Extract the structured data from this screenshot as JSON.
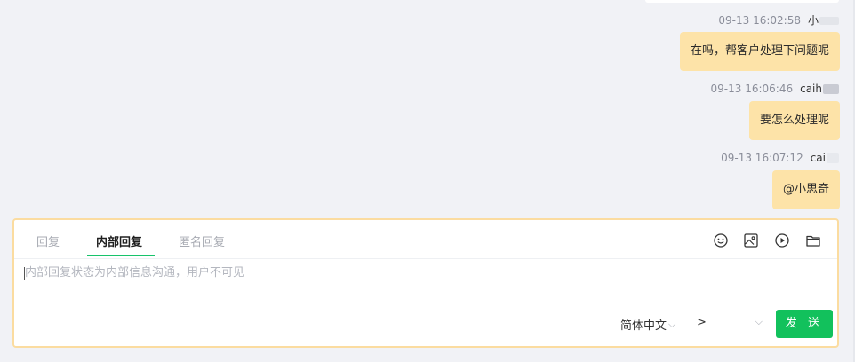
{
  "messages": [
    {
      "time": "09-13 16:02:58",
      "name": "小",
      "text": "在吗，帮客户处理下问题呢"
    },
    {
      "time": "09-13 16:06:46",
      "name": "caih",
      "text": "要怎么处理呢"
    },
    {
      "time": "09-13 16:07:12",
      "name": "cai",
      "text": "@小思奇"
    }
  ],
  "composer": {
    "tabs": [
      "回复",
      "内部回复",
      "匿名回复"
    ],
    "active_tab": "内部回复",
    "placeholder": "内部回复状态为内部信息沟通，用户不可见",
    "language": "简体中文",
    "target": ">",
    "send_label": "发 送",
    "icons": [
      "emoji-icon",
      "image-icon",
      "video-icon",
      "folder-icon"
    ]
  },
  "colors": {
    "bubble": "#fde3a8",
    "accent": "#12c15c",
    "composer_border": "#fbdca0",
    "background": "#f1f2f6"
  }
}
